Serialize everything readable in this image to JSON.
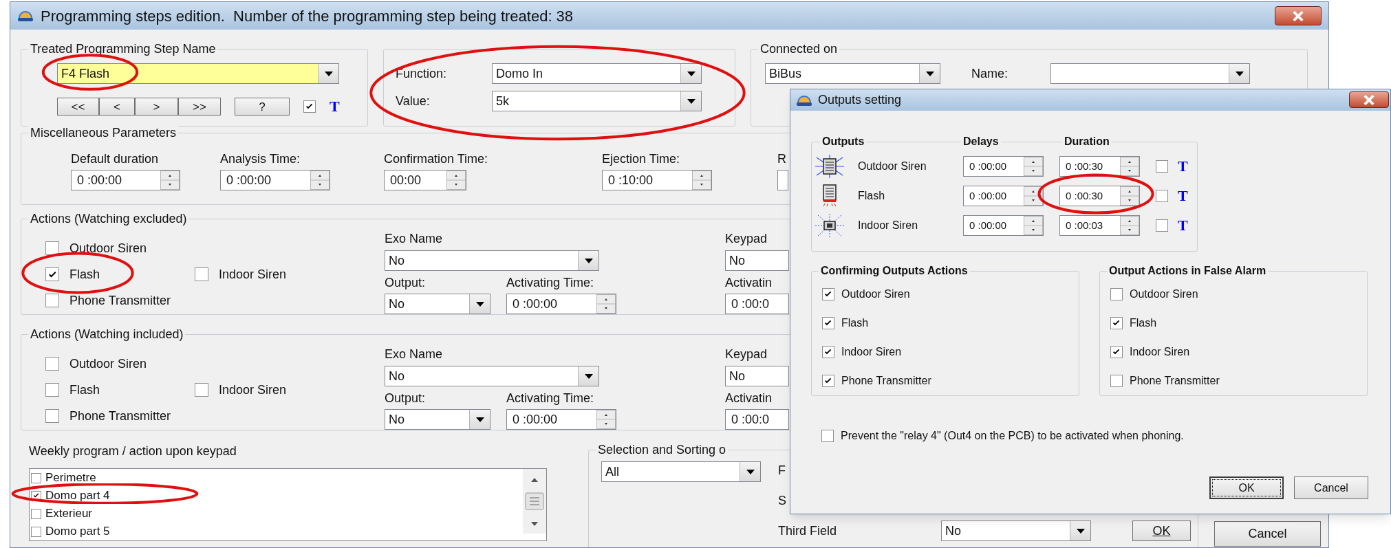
{
  "main_window": {
    "title": "Programming steps edition.  Number of the programming step being treated: 38",
    "step_name_group": {
      "title": "Treated Programming Step Name",
      "value": "F4  Flash",
      "nav_buttons": [
        "<<",
        "<",
        ">",
        ">>"
      ],
      "help_button": "?",
      "t_option": {
        "checked": true,
        "label": "T"
      }
    },
    "function_group": {
      "function_label": "Function:",
      "function_value": "Domo In",
      "value_label": "Value:",
      "value_value": "5k"
    },
    "connected_group": {
      "title": "Connected on",
      "bus": "BiBus",
      "name_label": "Name:"
    },
    "misc_group": {
      "title": "Miscellaneous Parameters",
      "fields": [
        {
          "label": "Default duration",
          "value": "0 :00:00"
        },
        {
          "label": "Analysis Time:",
          "value": "0 :00:00"
        },
        {
          "label": "Confirmation Time:",
          "value": "00:00"
        },
        {
          "label": "Ejection Time:",
          "value": "0 :10:00"
        },
        {
          "label": "R"
        }
      ]
    },
    "action_groups": [
      {
        "title": "Actions (Watching excluded)",
        "outputs": [
          {
            "label": "Outdoor Siren",
            "checked": false
          },
          {
            "label": "Flash",
            "checked": true
          },
          {
            "label": "Indoor Siren",
            "checked": false
          },
          {
            "label": "Phone Transmitter",
            "checked": false
          }
        ],
        "exo_label": "Exo Name",
        "exo_value": "No",
        "output_label": "Output:",
        "output_value": "No",
        "activating_label": "Activating Time:",
        "activating_value": "0 :00:00",
        "keypad_label": "Keypad",
        "keypad_value": "No",
        "keypad_activating_label": "Activatin",
        "keypad_activating_value": "0 :00:0"
      },
      {
        "title": "Actions (Watching included)",
        "outputs": [
          {
            "label": "Outdoor Siren",
            "checked": false
          },
          {
            "label": "Flash",
            "checked": false
          },
          {
            "label": "Indoor Siren",
            "checked": false
          },
          {
            "label": "Phone Transmitter",
            "checked": false
          }
        ],
        "exo_label": "Exo Name",
        "exo_value": "No",
        "output_label": "Output:",
        "output_value": "No",
        "activating_label": "Activating Time:",
        "activating_value": "0 :00:00",
        "keypad_label": "Keypad",
        "keypad_value": "No",
        "keypad_activating_label": "Activatin",
        "keypad_activating_value": "0 :00:0"
      }
    ],
    "weekly": {
      "title": "Weekly program / action upon keypad",
      "items": [
        {
          "label": "Perimetre",
          "checked": false
        },
        {
          "label": "Domo part 4",
          "checked": true
        },
        {
          "label": "Exterieur",
          "checked": false
        },
        {
          "label": "Domo part 5",
          "checked": false
        }
      ]
    },
    "selection_group": {
      "title": "Selection and Sorting o",
      "filter": "All",
      "field_labels": [
        "F",
        "S"
      ],
      "third_field_label": "Third Field",
      "third_field_value": "No",
      "ok_button": "OK"
    },
    "cancel_button": "Cancel"
  },
  "outputs_dialog": {
    "title": "Outputs setting",
    "headers": [
      "Outputs",
      "Delays",
      "Duration"
    ],
    "outputs": [
      {
        "kind": "outdoor_siren",
        "label": "Outdoor Siren",
        "delay": "0 :00:00",
        "duration": "0 :00:30",
        "t_checked": false,
        "t_label": "T"
      },
      {
        "kind": "flash",
        "label": "Flash",
        "delay": "0 :00:00",
        "duration": "0 :00:30",
        "t_checked": false,
        "t_label": "T"
      },
      {
        "kind": "indoor_siren",
        "label": "Indoor Siren",
        "delay": "0 :00:00",
        "duration": "0 :00:03",
        "t_checked": false,
        "t_label": "T"
      }
    ],
    "confirming": {
      "title": "Confirming Outputs Actions",
      "items": [
        {
          "label": "Outdoor Siren",
          "checked": true
        },
        {
          "label": "Flash",
          "checked": true
        },
        {
          "label": "Indoor Siren",
          "checked": true
        },
        {
          "label": "Phone Transmitter",
          "checked": true
        }
      ]
    },
    "false_alarm": {
      "title": "Output Actions in False Alarm",
      "items": [
        {
          "label": "Outdoor Siren",
          "checked": false
        },
        {
          "label": "Flash",
          "checked": true
        },
        {
          "label": "Indoor Siren",
          "checked": true
        },
        {
          "label": "Phone Transmitter",
          "checked": false
        }
      ]
    },
    "prevent": {
      "label": "Prevent the \"relay 4\" (Out4 on the PCB) to be activated when phoning.",
      "checked": false
    },
    "buttons": [
      {
        "label": "OK",
        "default": true
      },
      {
        "label": "Cancel",
        "default": false
      }
    ]
  }
}
